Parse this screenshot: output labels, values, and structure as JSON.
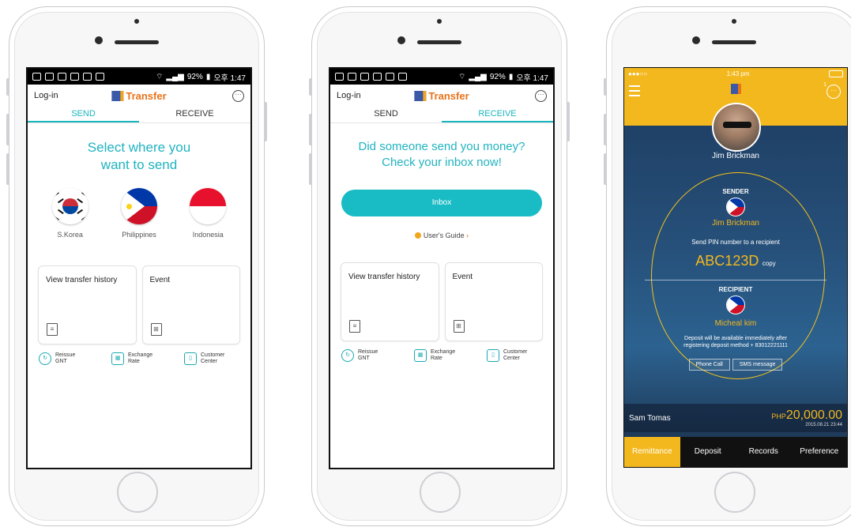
{
  "android_status": {
    "battery": "92%",
    "time": "오후 1:47"
  },
  "app": {
    "login_label": "Log-in",
    "logo_text": "Transfer",
    "tab_send": "SEND",
    "tab_receive": "RECEIVE"
  },
  "send_screen": {
    "headline_line1": "Select where you",
    "headline_line2": "want to send",
    "countries": [
      "S.Korea",
      "Philippines",
      "Indonesia"
    ],
    "card_history": "View transfer history",
    "card_event": "Event",
    "quick_reissue": [
      "Reissue",
      "GNT"
    ],
    "quick_exchange": [
      "Exchange",
      "Rate"
    ],
    "quick_customer": [
      "Customer",
      "Center"
    ]
  },
  "receive_screen": {
    "headline_line1": "Did someone send you money?",
    "headline_line2": "Check your inbox now!",
    "inbox_button": "Inbox",
    "guide_link": "User's Guide",
    "card_history": "View transfer history",
    "card_event": "Event",
    "quick_reissue": [
      "Reissue",
      "GNT"
    ],
    "quick_exchange": [
      "Exchange",
      "Rate"
    ],
    "quick_customer": [
      "Customer",
      "Center"
    ]
  },
  "ios_screen": {
    "status_time": "1:43 pm",
    "chat_count": "1",
    "user_name": "Jim Brickman",
    "sender_label": "SENDER",
    "sender_name": "Jim Brickman",
    "pin_instruction": "Send PIN number to a recipient",
    "pin_code": "ABC123D",
    "copy_label": "copy",
    "recipient_label": "RECIPIENT",
    "recipient_name": "Micheal kim",
    "deposit_note_line1": "Deposit will be available immediately after",
    "deposit_note_line2": "registering deposit method + 83012221111",
    "phone_call_button": "Phone Call",
    "sms_button": "SMS message",
    "account_name": "Sam Tomas",
    "currency": "PHP",
    "amount": "20,000.00",
    "timestamp": "2015.08.21 23:44",
    "tabs": [
      "Remittance",
      "Deposit",
      "Records",
      "Preference"
    ]
  },
  "colors": {
    "teal": "#19b6bf",
    "orange": "#e8731a",
    "yellow": "#f3b81d"
  }
}
